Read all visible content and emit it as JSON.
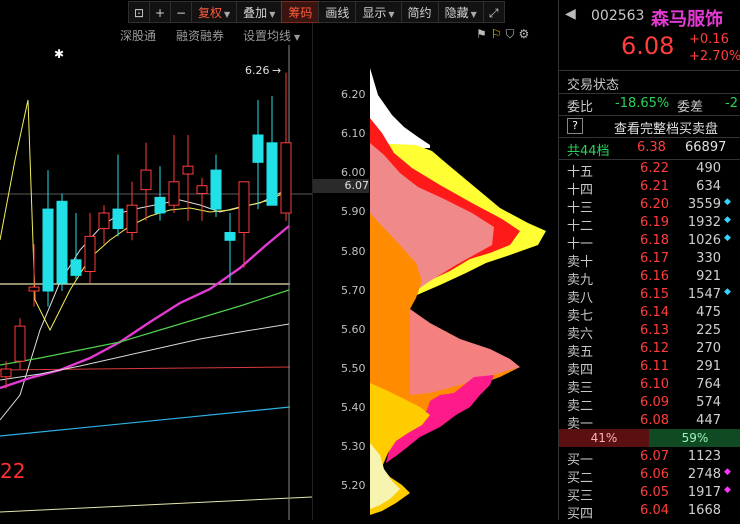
{
  "toolbar": {
    "lock_icon": "lock-icon",
    "plus_label": "+",
    "minus_label": "−",
    "fuquan_label": "复权",
    "diejia_label": "叠加",
    "chouma_label": "筹码",
    "huaxian_label": "画线",
    "xianshi_label": "显示",
    "jianjie_label": "简约",
    "yincang_label": "隐藏",
    "fullscreen_icon": "expand-icon"
  },
  "subbar": {
    "shengutong": "深股通",
    "rongzirongquan": "融资融券",
    "shezhi_junxian": "设置均线"
  },
  "chart": {
    "high_marker": "6.26",
    "left_bottom_number": "22",
    "candles": [
      {
        "o": 5.48,
        "h": 5.52,
        "l": 5.45,
        "c": 5.5,
        "up": true
      },
      {
        "o": 5.52,
        "h": 5.63,
        "l": 5.5,
        "c": 5.61,
        "up": true
      },
      {
        "o": 5.71,
        "h": 5.82,
        "l": 5.66,
        "c": 5.7,
        "up": true
      },
      {
        "o": 5.7,
        "h": 6.01,
        "l": 5.66,
        "c": 5.91,
        "up": false
      },
      {
        "o": 5.93,
        "h": 5.95,
        "l": 5.7,
        "c": 5.72,
        "up": false
      },
      {
        "o": 5.78,
        "h": 5.9,
        "l": 5.73,
        "c": 5.74,
        "up": false
      },
      {
        "o": 5.75,
        "h": 5.9,
        "l": 5.72,
        "c": 5.84,
        "up": true
      },
      {
        "o": 5.86,
        "h": 5.92,
        "l": 5.82,
        "c": 5.9,
        "up": true
      },
      {
        "o": 5.91,
        "h": 6.05,
        "l": 5.84,
        "c": 5.86,
        "up": false
      },
      {
        "o": 5.85,
        "h": 5.98,
        "l": 5.83,
        "c": 5.92,
        "up": true
      },
      {
        "o": 5.96,
        "h": 6.08,
        "l": 5.88,
        "c": 6.01,
        "up": true
      },
      {
        "o": 5.94,
        "h": 6.02,
        "l": 5.88,
        "c": 5.9,
        "up": false
      },
      {
        "o": 5.92,
        "h": 6.1,
        "l": 5.9,
        "c": 5.98,
        "up": true
      },
      {
        "o": 6.0,
        "h": 6.1,
        "l": 5.88,
        "c": 6.02,
        "up": true
      },
      {
        "o": 5.95,
        "h": 5.99,
        "l": 5.88,
        "c": 5.97,
        "up": true
      },
      {
        "o": 6.01,
        "h": 6.05,
        "l": 5.89,
        "c": 5.91,
        "up": false
      },
      {
        "o": 5.83,
        "h": 5.9,
        "l": 5.72,
        "c": 5.85,
        "up": false
      },
      {
        "o": 5.85,
        "h": 5.95,
        "l": 5.76,
        "c": 5.98,
        "up": true
      },
      {
        "o": 6.1,
        "h": 6.19,
        "l": 5.91,
        "c": 6.03,
        "up": false
      },
      {
        "o": 6.08,
        "h": 6.2,
        "l": 5.92,
        "c": 5.92,
        "up": false
      },
      {
        "o": 5.9,
        "h": 6.26,
        "l": 5.88,
        "c": 6.08,
        "up": true
      }
    ]
  },
  "price_axis": {
    "labels": [
      "6.20",
      "6.10",
      "6.00",
      "5.90",
      "5.80",
      "5.70",
      "5.60",
      "5.50",
      "5.40",
      "5.30",
      "5.20"
    ],
    "current": "6.07"
  },
  "quote": {
    "code": "002563",
    "name": "森马服饰",
    "price": "6.08",
    "change": "+0.16",
    "change_pct": "+2.70%",
    "trade_status_label": "交易状态",
    "weibi_label": "委比",
    "weibi_value": "-18.65%",
    "weicha_label": "委差",
    "weicha_value": "-2",
    "view_full_label": "查看完整档买卖盘",
    "question_icon": "?",
    "total_levels_label": "共44档",
    "total_levels_price": "6.38",
    "total_levels_vol": "66897",
    "asks": [
      {
        "level": "十五",
        "price": "6.22",
        "vol": "490",
        "dot": "",
        "dot_color": ""
      },
      {
        "level": "十四",
        "price": "6.21",
        "vol": "634",
        "dot": "",
        "dot_color": ""
      },
      {
        "level": "十三",
        "price": "6.20",
        "vol": "3559",
        "dot": "◆",
        "dot_color": "cyan"
      },
      {
        "level": "十二",
        "price": "6.19",
        "vol": "1932",
        "dot": "◆",
        "dot_color": "cyan"
      },
      {
        "level": "十一",
        "price": "6.18",
        "vol": "1026",
        "dot": "◆",
        "dot_color": "cyan"
      },
      {
        "level": "卖十",
        "price": "6.17",
        "vol": "330",
        "dot": "",
        "dot_color": ""
      },
      {
        "level": "卖九",
        "price": "6.16",
        "vol": "921",
        "dot": "",
        "dot_color": ""
      },
      {
        "level": "卖八",
        "price": "6.15",
        "vol": "1547",
        "dot": "◆",
        "dot_color": "cyan"
      },
      {
        "level": "卖七",
        "price": "6.14",
        "vol": "475",
        "dot": "",
        "dot_color": ""
      },
      {
        "level": "卖六",
        "price": "6.13",
        "vol": "225",
        "dot": "",
        "dot_color": ""
      },
      {
        "level": "卖五",
        "price": "6.12",
        "vol": "270",
        "dot": "",
        "dot_color": ""
      },
      {
        "level": "卖四",
        "price": "6.11",
        "vol": "291",
        "dot": "",
        "dot_color": ""
      },
      {
        "level": "卖三",
        "price": "6.10",
        "vol": "764",
        "dot": "",
        "dot_color": ""
      },
      {
        "level": "卖二",
        "price": "6.09",
        "vol": "574",
        "dot": "",
        "dot_color": ""
      },
      {
        "level": "卖一",
        "price": "6.08",
        "vol": "447",
        "dot": "",
        "dot_color": ""
      }
    ],
    "ratio_sell": "41%",
    "ratio_buy": "59%",
    "bids": [
      {
        "level": "买一",
        "price": "6.07",
        "vol": "1123",
        "dot": "",
        "dot_color": ""
      },
      {
        "level": "买二",
        "price": "6.06",
        "vol": "2748",
        "dot": "◆",
        "dot_color": "mag"
      },
      {
        "level": "买三",
        "price": "6.05",
        "vol": "1917",
        "dot": "◆",
        "dot_color": "mag"
      },
      {
        "level": "买四",
        "price": "6.04",
        "vol": "1668",
        "dot": "",
        "dot_color": ""
      }
    ]
  },
  "colors": {
    "up": "#ff3d3d",
    "down": "#22e0e8",
    "accent_name": "#e23ad2"
  }
}
